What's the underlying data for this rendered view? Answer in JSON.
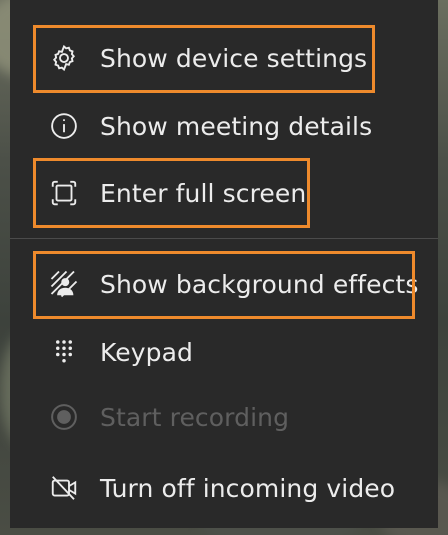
{
  "menu": {
    "items": [
      {
        "label": "Show device settings",
        "icon": "gear-icon",
        "enabled": true
      },
      {
        "label": "Show meeting details",
        "icon": "info-icon",
        "enabled": true
      },
      {
        "label": "Enter full screen",
        "icon": "fullscreen-icon",
        "enabled": true
      },
      {
        "label": "Show background effects",
        "icon": "background-effects-icon",
        "enabled": true
      },
      {
        "label": "Keypad",
        "icon": "keypad-icon",
        "enabled": true
      },
      {
        "label": "Start recording",
        "icon": "record-icon",
        "enabled": false
      },
      {
        "label": "Turn off incoming video",
        "icon": "video-off-icon",
        "enabled": true
      }
    ]
  },
  "colors": {
    "menu_background": "#292929",
    "text": "#ececec",
    "disabled_text": "#5f5f5f",
    "highlight": "#ee8a2c",
    "divider": "#4b4b4b"
  }
}
